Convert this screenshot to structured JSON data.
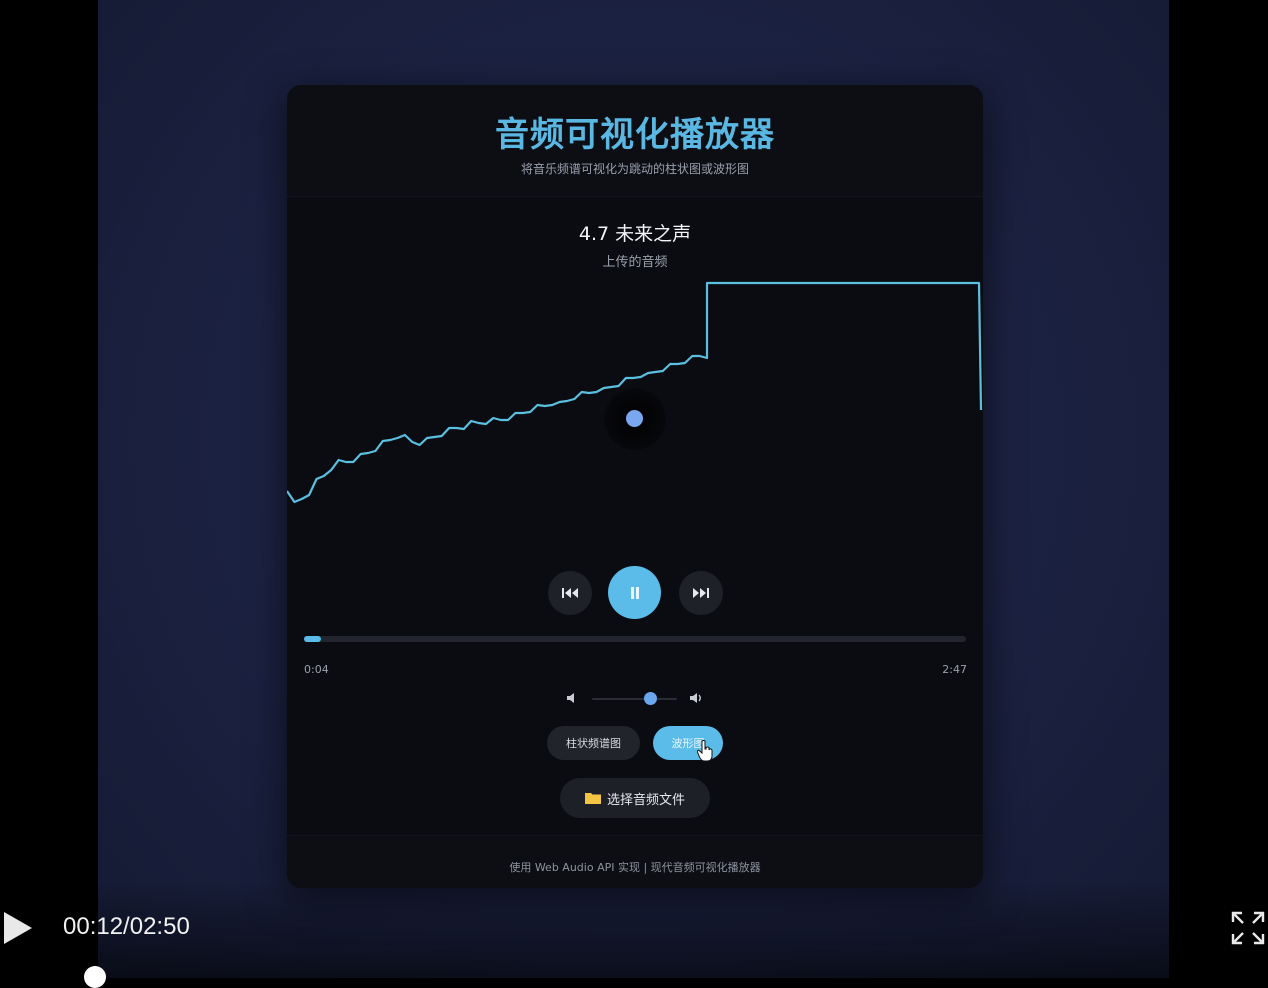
{
  "app": {
    "title": "音频可视化播放器",
    "subtitle": "将音乐频谱可视化为跳动的柱状图或波形图"
  },
  "track": {
    "title": "4.7 未来之声",
    "subtitle": "上传的音频"
  },
  "visualizer": {
    "mode": "waveform",
    "color": "#5bbfe0",
    "level_samples": [
      0.22,
      0.06,
      0.12,
      0.18,
      0.29,
      0.35,
      0.43,
      0.48,
      0.49,
      0.51,
      0.54,
      0.58,
      0.62,
      0.67,
      0.71,
      0.75,
      0.73,
      0.69,
      0.68,
      0.7,
      0.74,
      0.77,
      0.8,
      0.83,
      0.84,
      0.87,
      0.88,
      0.89,
      0.9,
      0.91,
      0.93,
      0.95,
      0.98,
      1.01,
      1.03,
      1.05,
      1.08,
      1.06,
      1.1,
      1.14,
      1.16,
      1.18,
      1.21,
      1.2,
      1.24,
      1.27,
      1.3,
      1.33,
      1.36,
      1.35,
      1.39,
      1.42,
      1.44,
      1.47,
      1.5,
      1.52,
      1.55,
      1.55
    ]
  },
  "player": {
    "prev_icon": "rewind-icon",
    "play_pause_icon": "pause-icon",
    "next_icon": "fast-forward-icon",
    "current_time": "0:04",
    "duration": "2:47",
    "progress_fraction": 0.025,
    "volume_fraction": 0.68
  },
  "modes": {
    "bar_label": "柱状频谱图",
    "wave_label": "波形图",
    "active": "wave"
  },
  "file_button": {
    "icon": "folder-icon",
    "label": "选择音频文件"
  },
  "footer": {
    "text": "使用 Web Audio API 实现 | 现代音频可视化播放器"
  },
  "video_controls": {
    "time": "00:12/02:50",
    "play_icon": "play-icon",
    "fullscreen_icon": "fullscreen-icon"
  },
  "colors": {
    "accent": "#5bbbe9",
    "title": "#5ab7e2",
    "card_bg": "#0b0c12",
    "stage_bg": "#1d2342"
  }
}
